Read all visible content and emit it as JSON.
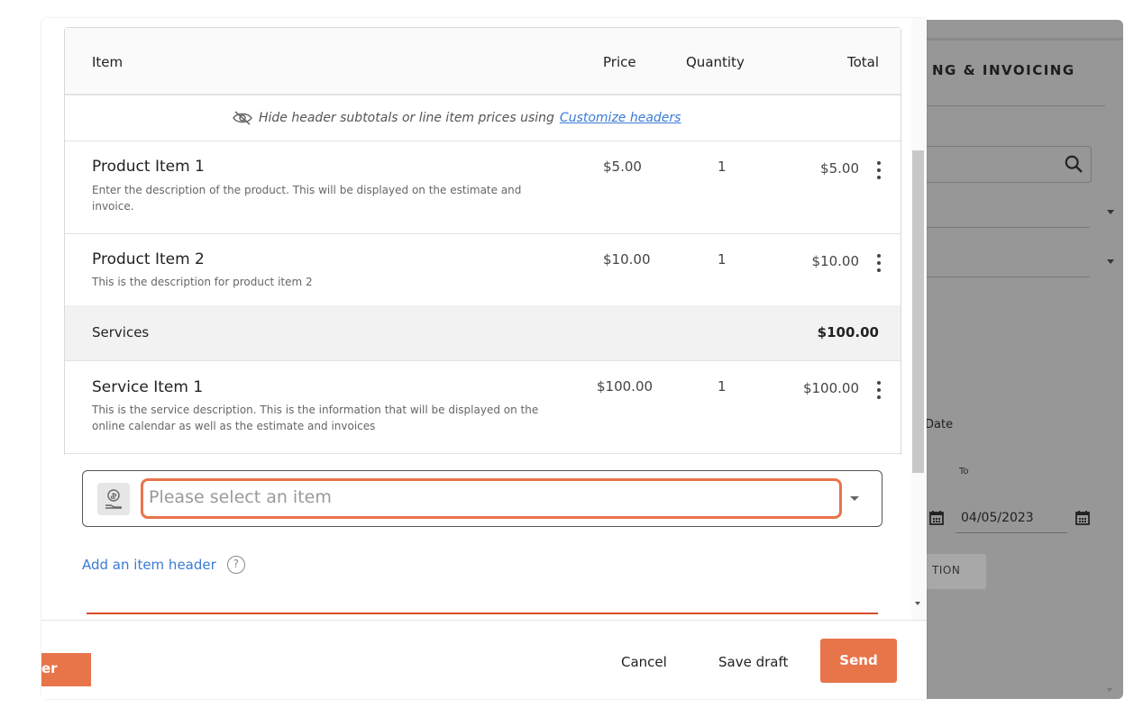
{
  "background": {
    "section_title": "NG & INVOICING",
    "date_label": "Date",
    "to_label": "To",
    "to_date": "04/05/2023",
    "action_button": "TION"
  },
  "table": {
    "headers": {
      "item": "Item",
      "price": "Price",
      "quantity": "Quantity",
      "total": "Total"
    },
    "hint": {
      "text": "Hide header subtotals or line item prices using",
      "link": "Customize headers"
    },
    "products": [
      {
        "name": "Product Item 1",
        "description": "Enter the description of the product. This will be displayed on the estimate and invoice.",
        "price": "$5.00",
        "quantity": "1",
        "total": "$5.00"
      },
      {
        "name": "Product Item 2",
        "description": "This is the description for product item 2",
        "price": "$10.00",
        "quantity": "1",
        "total": "$10.00"
      }
    ],
    "section": {
      "name": "Services",
      "total": "$100.00"
    },
    "services": [
      {
        "name": "Service Item 1",
        "description": "This is the service description. This is the information that will be displayed on the online calendar as well as the estimate and invoices",
        "price": "$100.00",
        "quantity": "1",
        "total": "$100.00"
      }
    ]
  },
  "item_picker": {
    "placeholder": "Please select an item"
  },
  "add_item_header": {
    "label": "Add an item header",
    "help": "?"
  },
  "footer": {
    "left_button": "er",
    "cancel": "Cancel",
    "save_draft": "Save draft",
    "send": "Send"
  },
  "colors": {
    "accent": "#e8744a",
    "link": "#3a7bd5",
    "error_line": "#d94c2c"
  }
}
